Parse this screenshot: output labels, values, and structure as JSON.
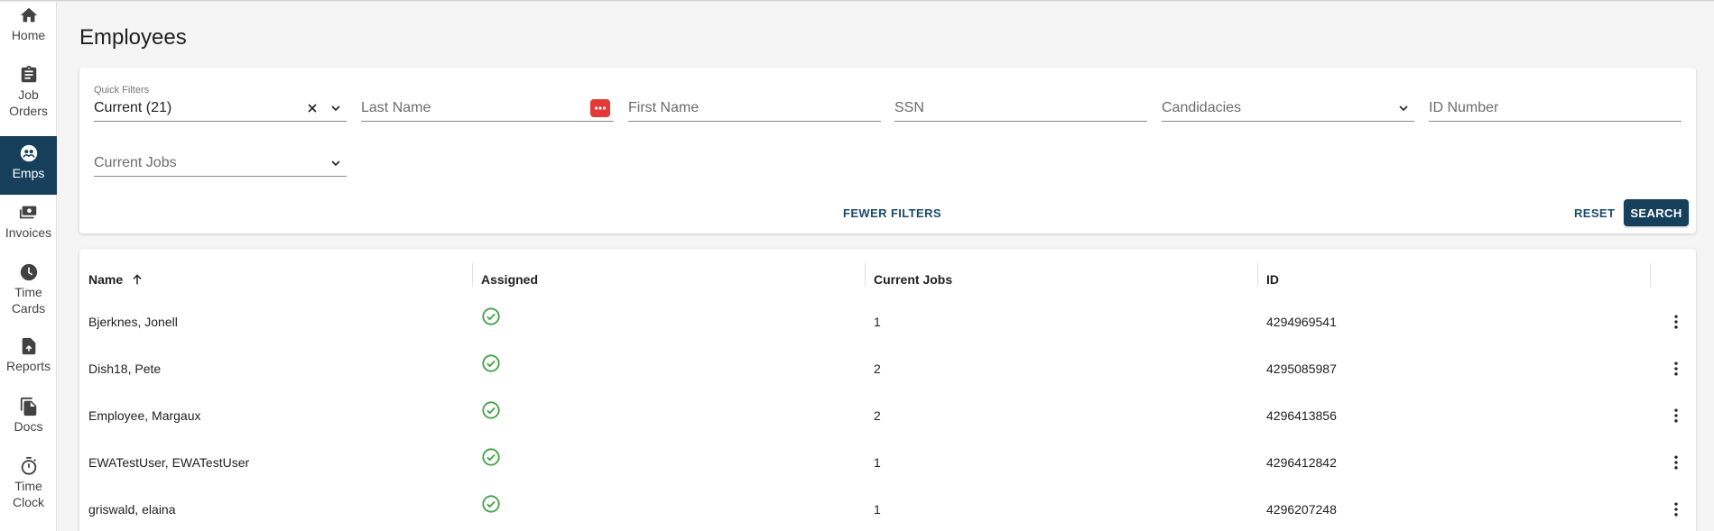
{
  "sidebar": {
    "items": [
      {
        "label": "Home",
        "icon": "home-icon",
        "active": false
      },
      {
        "label": "Job\nOrders",
        "icon": "clipboard-icon",
        "active": false
      },
      {
        "label": "Emps",
        "icon": "employees-icon",
        "active": true
      },
      {
        "label": "Invoices",
        "icon": "invoices-icon",
        "active": false
      },
      {
        "label": "Time\nCards",
        "icon": "clock-icon",
        "active": false
      },
      {
        "label": "Reports",
        "icon": "report-upload-icon",
        "active": false
      },
      {
        "label": "Docs",
        "icon": "documents-icon",
        "active": false
      },
      {
        "label": "Time\nClock",
        "icon": "stopwatch-icon",
        "active": false
      }
    ]
  },
  "page": {
    "title": "Employees"
  },
  "filters": {
    "quick_filters_label": "Quick Filters",
    "quick_filters_value": "Current (21)",
    "last_name_placeholder": "Last Name",
    "first_name_placeholder": "First Name",
    "ssn_placeholder": "SSN",
    "candidacies_placeholder": "Candidacies",
    "id_number_placeholder": "ID Number",
    "current_jobs_placeholder": "Current Jobs",
    "fewer_filters_label": "FEWER FILTERS",
    "reset_label": "RESET",
    "search_label": "SEARCH"
  },
  "table": {
    "headers": {
      "name": "Name",
      "assigned": "Assigned",
      "current_jobs": "Current Jobs",
      "id": "ID"
    },
    "sort": {
      "column": "Name",
      "direction": "ascending"
    },
    "rows": [
      {
        "name": "Bjerknes, Jonell",
        "assigned": true,
        "current_jobs": "1",
        "id": "4294969541"
      },
      {
        "name": "Dish18, Pete",
        "assigned": true,
        "current_jobs": "2",
        "id": "4295085987"
      },
      {
        "name": "Employee, Margaux",
        "assigned": true,
        "current_jobs": "2",
        "id": "4296413856"
      },
      {
        "name": "EWATestUser, EWATestUser",
        "assigned": true,
        "current_jobs": "1",
        "id": "4296412842"
      },
      {
        "name": "griswald, elaina",
        "assigned": true,
        "current_jobs": "1",
        "id": "4296207248"
      }
    ]
  },
  "colors": {
    "primary": "#163f5c",
    "accent_red": "#e53935",
    "success_green": "#43a047"
  }
}
